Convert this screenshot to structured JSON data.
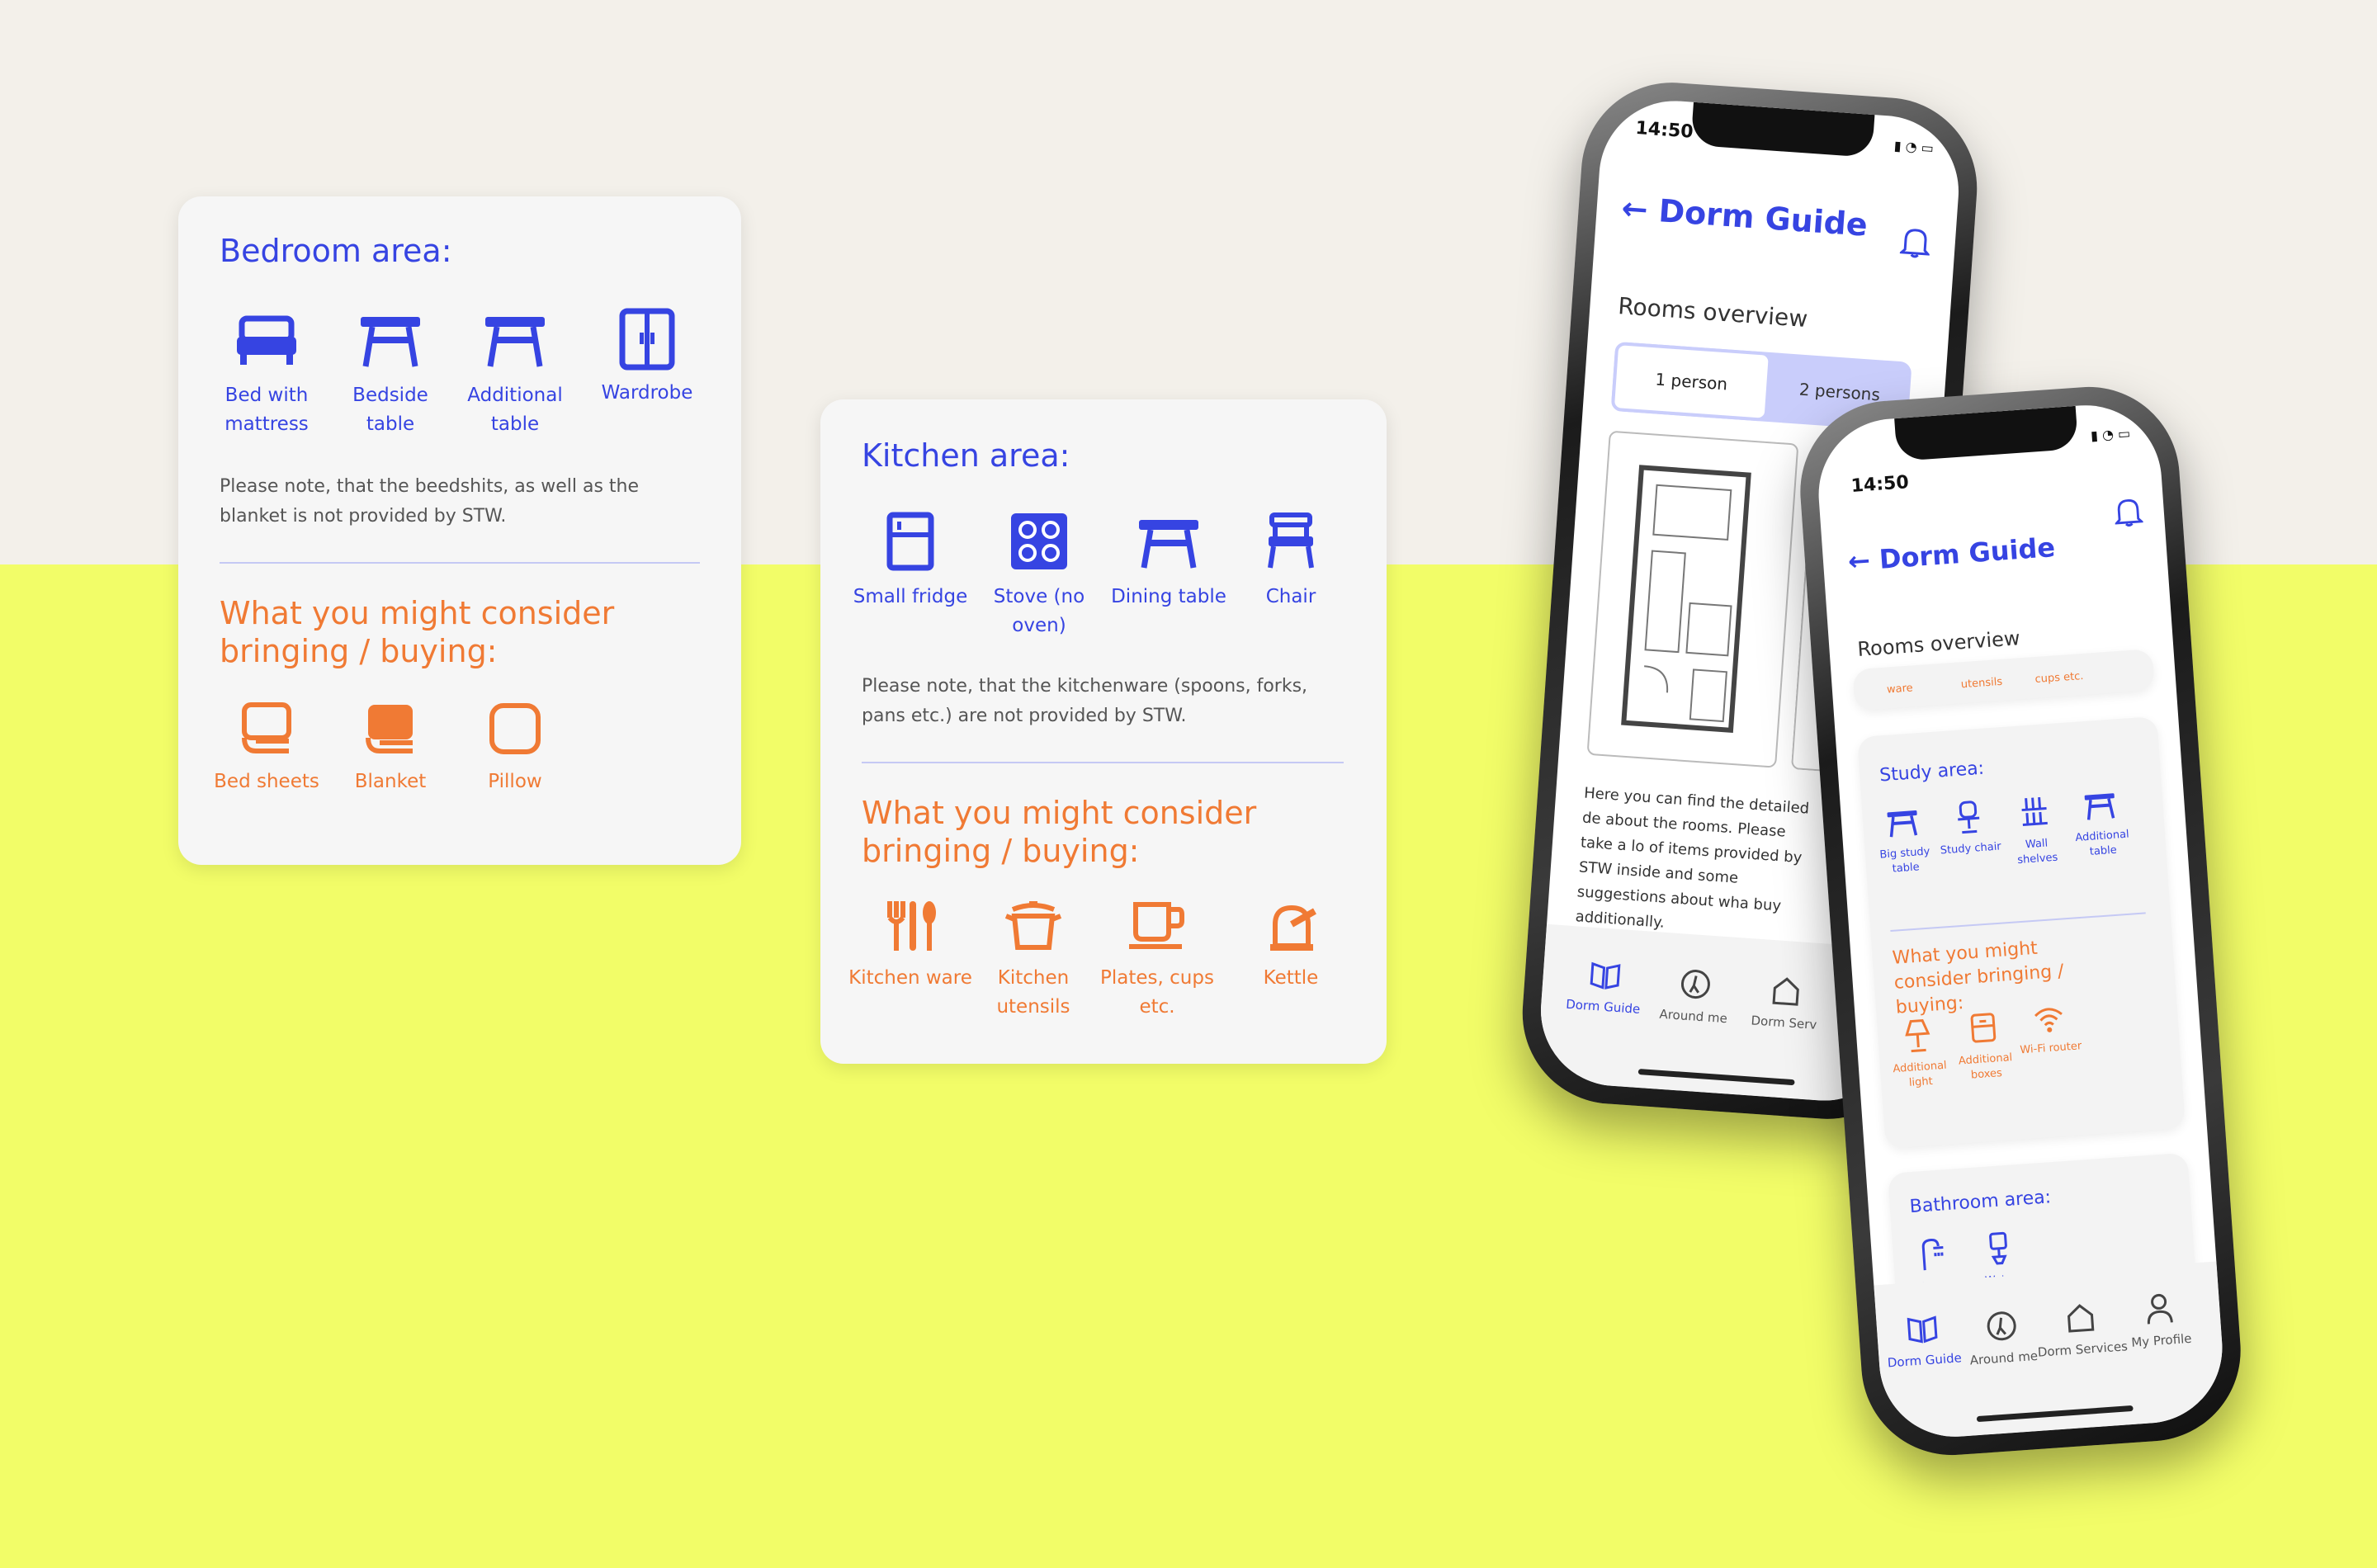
{
  "colors": {
    "blue": "#3644e2",
    "orange": "#f07a34",
    "yellow": "#f2fd68",
    "cream": "#f3f0ea"
  },
  "bedroom": {
    "title": "Bedroom area:",
    "items": [
      {
        "label": "Bed with mattress",
        "icon": "bed-icon"
      },
      {
        "label": "Bedside table",
        "icon": "table-icon"
      },
      {
        "label": "Additional table",
        "icon": "table-icon"
      },
      {
        "label": "Wardrobe",
        "icon": "wardrobe-icon"
      }
    ],
    "note": "Please note, that the beedshits, as well as the blanket is not provided by STW.",
    "consider_title": "What you might consider bringing / buying:",
    "consider": [
      {
        "label": "Bed sheets",
        "icon": "bed-sheets-icon"
      },
      {
        "label": "Blanket",
        "icon": "blanket-icon"
      },
      {
        "label": "Pillow",
        "icon": "pillow-icon"
      }
    ]
  },
  "kitchen": {
    "title": "Kitchen area:",
    "items": [
      {
        "label": "Small fridge",
        "icon": "fridge-icon"
      },
      {
        "label": "Stove (no oven)",
        "icon": "stove-icon"
      },
      {
        "label": "Dining table",
        "icon": "table-icon"
      },
      {
        "label": "Chair",
        "icon": "chair-icon"
      }
    ],
    "note": "Please note, that the kitchenware (spoons, forks, pans etc.) are not provided by STW.",
    "consider_title": "What you might consider bringing / buying:",
    "consider": [
      {
        "label": "Kitchen ware",
        "icon": "cutlery-icon"
      },
      {
        "label": "Kitchen utensils",
        "icon": "pot-icon"
      },
      {
        "label": "Plates, cups etc.",
        "icon": "cup-icon"
      },
      {
        "label": "Kettle",
        "icon": "kettle-icon"
      }
    ]
  },
  "phone_back": {
    "time": "14:50",
    "title": "Dorm Guide",
    "section": "Rooms overview",
    "seg_on": "1 person",
    "seg_off": "2 persons",
    "paragraph": "Here you can find the detailed de about the rooms. Please take a lo of items provided by STW inside and some suggestions about wha buy additionally.",
    "tabs": [
      "Dorm Guide",
      "Around me",
      "Dorm Serv"
    ]
  },
  "phone_front": {
    "time": "14:50",
    "title": "Dorm Guide",
    "section": "Rooms overview",
    "chips": [
      "ware",
      "utensils",
      "cups etc."
    ],
    "study": {
      "title": "Study area:",
      "items": [
        "Big study table",
        "Study chair",
        "Wall shelves",
        "Additional table"
      ],
      "consider_title": "What you might consider bringing / buying:",
      "consider": [
        "Additional light",
        "Additional boxes",
        "Wi-Fi router"
      ]
    },
    "bathroom": {
      "title": "Bathroom area:",
      "items": [
        "Shower",
        "Water"
      ]
    },
    "tabs": [
      "Dorm Guide",
      "Around me",
      "Dorm Services",
      "My Profile"
    ]
  }
}
